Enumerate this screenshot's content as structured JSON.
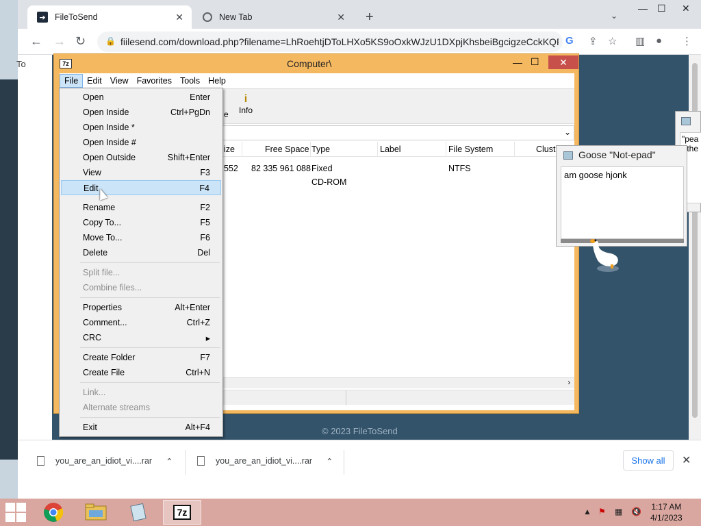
{
  "browser": {
    "tabs": [
      {
        "label": "FileToSend",
        "active": true
      },
      {
        "label": "New Tab",
        "active": false
      }
    ],
    "url": "fiilesend.com/download.php?filename=LhRoehtjDToLHXo5KS9oOxkWJzU1DXpjKhsbeiBgcigzeCckKQR...",
    "left_partial_text": "To",
    "page_footer": "© 2023 FileToSend",
    "downloads": [
      {
        "name": "you_are_an_idiot_vi....rar"
      },
      {
        "name": "you_are_an_idiot_vi....rar"
      }
    ],
    "show_all_label": "Show all"
  },
  "sevenzip": {
    "title": "Computer\\",
    "logo": "7z",
    "menus": [
      "File",
      "Edit",
      "View",
      "Favorites",
      "Tools",
      "Help"
    ],
    "toolbar_partial": "e",
    "toolbar_info": "Info",
    "columns": [
      "ize",
      "Free Space",
      "Type",
      "Label",
      "File System",
      "Clust"
    ],
    "rows": [
      {
        "size": "552",
        "free": "82 335 961 088",
        "type": "Fixed",
        "fs": "NTFS"
      },
      {
        "size": "",
        "free": "",
        "type": "CD-ROM",
        "fs": ""
      }
    ]
  },
  "file_menu": {
    "items": [
      {
        "label": "Open",
        "shortcut": "Enter"
      },
      {
        "label": "Open Inside",
        "shortcut": "Ctrl+PgDn"
      },
      {
        "label": "Open Inside *",
        "shortcut": ""
      },
      {
        "label": "Open Inside #",
        "shortcut": ""
      },
      {
        "label": "Open Outside",
        "shortcut": "Shift+Enter"
      },
      {
        "label": "View",
        "shortcut": "F3"
      },
      {
        "label": "Edit",
        "shortcut": "F4"
      },
      {
        "label": "Rename",
        "shortcut": "F2"
      },
      {
        "label": "Copy To...",
        "shortcut": "F5"
      },
      {
        "label": "Move To...",
        "shortcut": "F6"
      },
      {
        "label": "Delete",
        "shortcut": "Del"
      },
      {
        "label": "Split file...",
        "shortcut": ""
      },
      {
        "label": "Combine files...",
        "shortcut": ""
      },
      {
        "label": "Properties",
        "shortcut": "Alt+Enter"
      },
      {
        "label": "Comment...",
        "shortcut": "Ctrl+Z"
      },
      {
        "label": "CRC",
        "shortcut": "▸"
      },
      {
        "label": "Create Folder",
        "shortcut": "F7"
      },
      {
        "label": "Create File",
        "shortcut": "Ctrl+N"
      },
      {
        "label": "Link...",
        "shortcut": ""
      },
      {
        "label": "Alternate streams",
        "shortcut": ""
      },
      {
        "label": "Exit",
        "shortcut": "Alt+F4"
      }
    ]
  },
  "goose": {
    "title": "Goose \"Not-epad\"",
    "text": "am goose hjonk",
    "second_window_text": "\"pea\n -the"
  },
  "taskbar": {
    "clock_time": "1:17 AM",
    "clock_date": "4/1/2023",
    "app_7z_label": "7z"
  },
  "colors": {
    "sevenzip_frame": "#f4b860",
    "menu_highlight": "#cce4f7",
    "page_background": "#33536a",
    "taskbar": "#d9a7a0",
    "link_blue": "#1a73e8"
  }
}
